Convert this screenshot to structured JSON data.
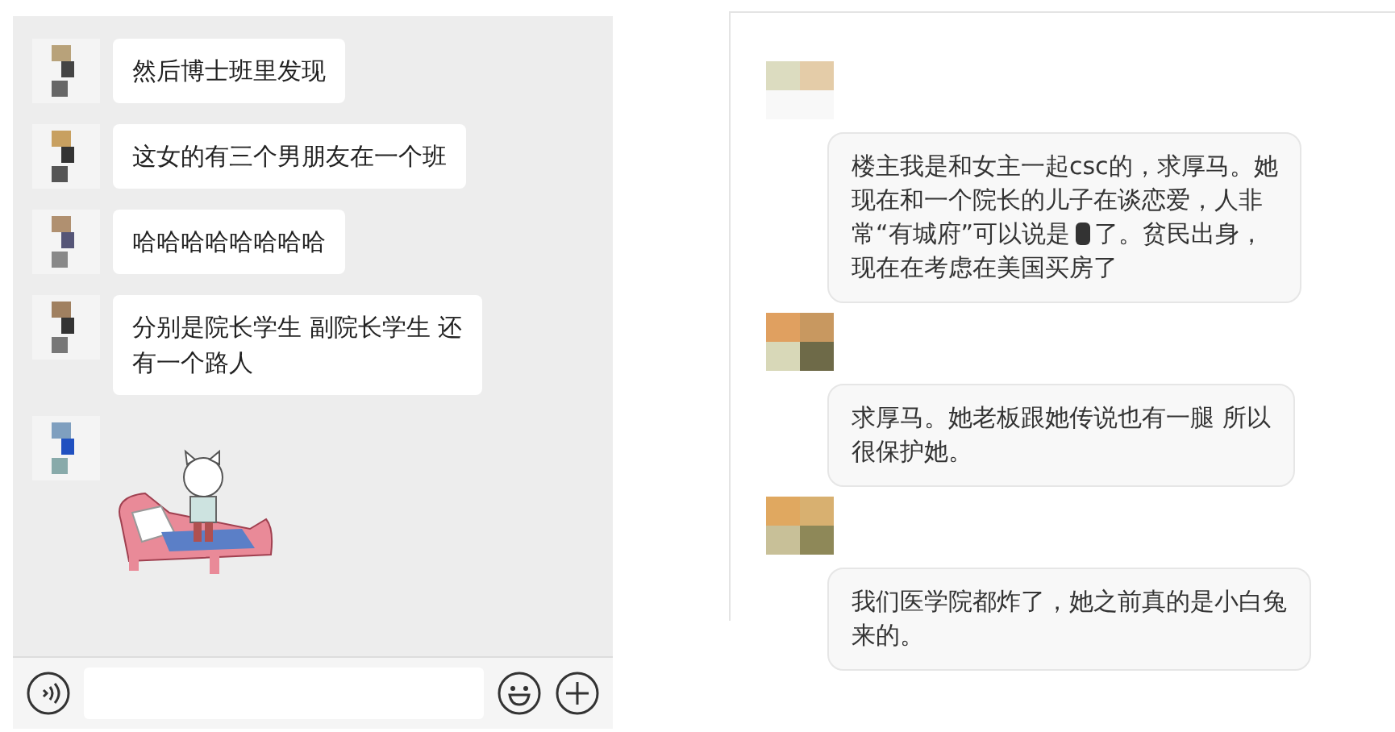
{
  "left_chat": {
    "messages": [
      {
        "kind": "text",
        "lines": [
          "然后博士班里发现"
        ]
      },
      {
        "kind": "text",
        "lines": [
          "这女的有三个男朋友在一个班"
        ]
      },
      {
        "kind": "text",
        "lines": [
          "哈哈哈哈哈哈哈哈"
        ]
      },
      {
        "kind": "text",
        "lines": [
          "分别是院长学生 副院长学生 还",
          "有一个路人"
        ]
      },
      {
        "kind": "sticker"
      }
    ]
  },
  "right_chat": {
    "messages": [
      {
        "lines": [
          [
            "楼主我是和女主一起csc的，求厚马。她"
          ],
          [
            "现在和一个院长的儿子在谈恋爱，人非"
          ],
          [
            "常“有城府”可以说是",
            "了。贫民出身，"
          ],
          [
            "现在在考虑在美国买房了"
          ]
        ]
      },
      {
        "lines": [
          [
            "求厚马。她老板跟她传说也有一腿 所以"
          ],
          [
            "很保护她。"
          ]
        ]
      },
      {
        "lines": [
          [
            "我们医学院都炸了，她之前真的是小白兔"
          ],
          [
            "来的。"
          ]
        ]
      }
    ]
  }
}
